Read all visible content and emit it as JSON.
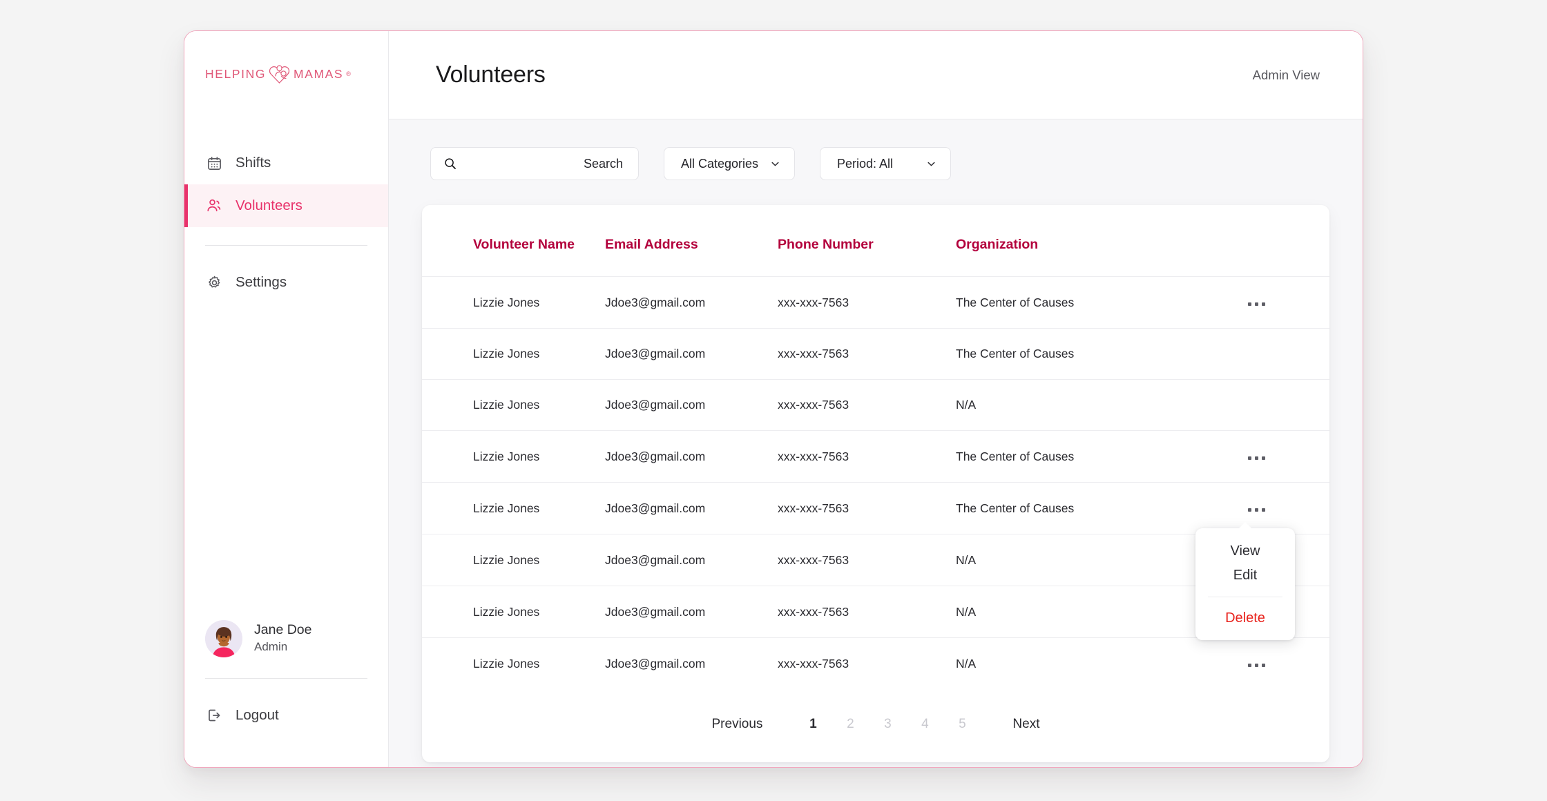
{
  "brand": {
    "name": "HELPING",
    "name2": "MAMAS",
    "trademark": "®",
    "logo_icon": "helping-mamas-heart-logo",
    "accent_color": "#e05878",
    "active_color": "#e8336b",
    "header_color": "#b3003c",
    "danger_color": "#e8221c"
  },
  "sidebar": {
    "items": [
      {
        "label": "Shifts",
        "icon": "calendar-icon",
        "active": false
      },
      {
        "label": "Volunteers",
        "icon": "users-icon",
        "active": true
      }
    ],
    "lower_items": [
      {
        "label": "Settings",
        "icon": "gear-icon",
        "active": false
      }
    ],
    "profile": {
      "name": "Jane Doe",
      "role": "Admin",
      "avatar": "user-avatar"
    },
    "logout": {
      "label": "Logout",
      "icon": "logout-icon"
    }
  },
  "header": {
    "title": "Volunteers",
    "admin_view": "Admin View"
  },
  "filters": {
    "search": {
      "label": "Search",
      "placeholder": "Search",
      "value": "",
      "icon": "search-icon"
    },
    "categories": {
      "label": "All Categories",
      "icon": "chevron-down-icon"
    },
    "period": {
      "label": "Period: All",
      "icon": "chevron-down-icon"
    }
  },
  "table": {
    "columns": [
      "Volunteer Name",
      "Email Address",
      "Phone Number",
      "Organization"
    ],
    "rows": [
      {
        "name": "Lizzie Jones",
        "email": "Jdoe3@gmail.com",
        "phone": "xxx-xxx-7563",
        "org": "The Center of Causes"
      },
      {
        "name": "Lizzie Jones",
        "email": "Jdoe3@gmail.com",
        "phone": "xxx-xxx-7563",
        "org": "The Center of Causes"
      },
      {
        "name": "Lizzie Jones",
        "email": "Jdoe3@gmail.com",
        "phone": "xxx-xxx-7563",
        "org": "N/A"
      },
      {
        "name": "Lizzie Jones",
        "email": "Jdoe3@gmail.com",
        "phone": "xxx-xxx-7563",
        "org": "The Center of Causes"
      },
      {
        "name": "Lizzie Jones",
        "email": "Jdoe3@gmail.com",
        "phone": "xxx-xxx-7563",
        "org": "The Center of Causes"
      },
      {
        "name": "Lizzie Jones",
        "email": "Jdoe3@gmail.com",
        "phone": "xxx-xxx-7563",
        "org": "N/A"
      },
      {
        "name": "Lizzie Jones",
        "email": "Jdoe3@gmail.com",
        "phone": "xxx-xxx-7563",
        "org": "N/A"
      },
      {
        "name": "Lizzie Jones",
        "email": "Jdoe3@gmail.com",
        "phone": "xxx-xxx-7563",
        "org": "N/A"
      }
    ],
    "row_action_icon": "more-options-icon"
  },
  "context_menu": {
    "open_for_row": 1,
    "items": [
      {
        "label": "View",
        "danger": false
      },
      {
        "label": "Edit",
        "danger": false
      },
      {
        "label": "Delete",
        "danger": true
      }
    ]
  },
  "pagination": {
    "previous": "Previous",
    "next": "Next",
    "pages": [
      "1",
      "2",
      "3",
      "4",
      "5"
    ],
    "current": "1"
  }
}
